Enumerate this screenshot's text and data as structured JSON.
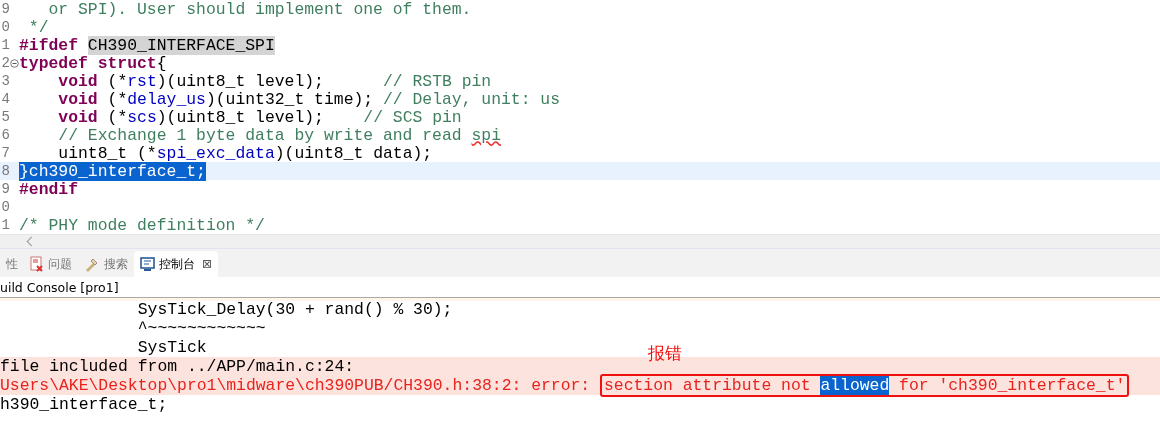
{
  "editor": {
    "lines": [
      {
        "number": "9",
        "tokens": [
          {
            "text": "   or SPI). User should implement one of them.",
            "kind": "comment"
          }
        ]
      },
      {
        "number": "0",
        "tokens": [
          {
            "text": " */",
            "kind": "comment"
          }
        ]
      },
      {
        "number": "1",
        "tokens": [
          {
            "text": "#ifdef ",
            "kind": "keyword"
          },
          {
            "text": "CH390_INTERFACE_SPI",
            "kind": "occurrence"
          }
        ]
      },
      {
        "number": "2",
        "fold": true,
        "tokens": [
          {
            "text": "typedef struct",
            "kind": "keyword"
          },
          {
            "text": "{",
            "kind": "plain"
          }
        ]
      },
      {
        "number": "3",
        "tokens": [
          {
            "text": "    void",
            "kind": "keyword"
          },
          {
            "text": " (*",
            "kind": "plain"
          },
          {
            "text": "rst",
            "kind": "field"
          },
          {
            "text": ")(uint8_t level);      ",
            "kind": "plain"
          },
          {
            "text": "// RSTB pin",
            "kind": "comment"
          }
        ]
      },
      {
        "number": "4",
        "tokens": [
          {
            "text": "    void",
            "kind": "keyword"
          },
          {
            "text": " (*",
            "kind": "plain"
          },
          {
            "text": "delay_us",
            "kind": "field"
          },
          {
            "text": ")(uint32_t time); ",
            "kind": "plain"
          },
          {
            "text": "// Delay, unit: us",
            "kind": "comment"
          }
        ]
      },
      {
        "number": "5",
        "tokens": [
          {
            "text": "    void",
            "kind": "keyword"
          },
          {
            "text": " (*",
            "kind": "plain"
          },
          {
            "text": "scs",
            "kind": "field"
          },
          {
            "text": ")(uint8_t level);    ",
            "kind": "plain"
          },
          {
            "text": "// SCS pin",
            "kind": "comment"
          }
        ]
      },
      {
        "number": "6",
        "tokens": [
          {
            "text": "    // Exchange 1 byte data by write and read ",
            "kind": "comment"
          },
          {
            "text": "spi",
            "kind": "misspelled"
          }
        ]
      },
      {
        "number": "7",
        "tokens": [
          {
            "text": "    uint8_t (*",
            "kind": "plain"
          },
          {
            "text": "spi_exc_data",
            "kind": "field"
          },
          {
            "text": ")(uint8_t data);",
            "kind": "plain"
          }
        ]
      },
      {
        "number": "8",
        "current": true,
        "tokens": [
          {
            "text": "}ch390_interface_t;",
            "kind": "selected"
          }
        ]
      },
      {
        "number": "9",
        "tokens": [
          {
            "text": "#endif",
            "kind": "keyword"
          }
        ]
      },
      {
        "number": "0"
      },
      {
        "number": "1",
        "tokens": [
          {
            "text": "/* PHY mode definition */",
            "kind": "comment"
          }
        ]
      }
    ]
  },
  "tabs": [
    {
      "label": "性",
      "selected": false
    },
    {
      "label": "问题",
      "selected": false
    },
    {
      "label": "搜索",
      "selected": false
    },
    {
      "label": "控制台",
      "selected": true,
      "close": "⊠"
    }
  ],
  "console": {
    "title": "uild Console [pro1]",
    "lines": [
      {
        "kind": "normal",
        "segments": [
          {
            "text": "              SysTick_Delay(30 + rand() % 30);",
            "kind": "plain"
          }
        ]
      },
      {
        "kind": "normal",
        "segments": [
          {
            "text": "              ^~~~~~~~~~~~~",
            "kind": "plain"
          }
        ]
      },
      {
        "kind": "normal",
        "segments": [
          {
            "text": "              SysTick",
            "kind": "plain"
          }
        ]
      },
      {
        "kind": "error",
        "segments": [
          {
            "text": "file included from ../APP/main.c:24:",
            "kind": "plain"
          }
        ]
      },
      {
        "kind": "error",
        "segments": [
          {
            "text": "Users\\AKE\\Desktop\\pro1\\midware\\ch390PUB/CH390.h:38:2: error: ",
            "kind": "error"
          },
          {
            "text": "section attribute not ",
            "kind": "boxed"
          },
          {
            "text": "allowed",
            "kind": "boxed-selected"
          },
          {
            "text": " for 'ch390_interface_t'",
            "kind": "boxed"
          }
        ]
      },
      {
        "kind": "normal",
        "segments": [
          {
            "text": "h390_interface_t;",
            "kind": "plain"
          }
        ]
      }
    ]
  },
  "annotation": {
    "text": "报错"
  }
}
